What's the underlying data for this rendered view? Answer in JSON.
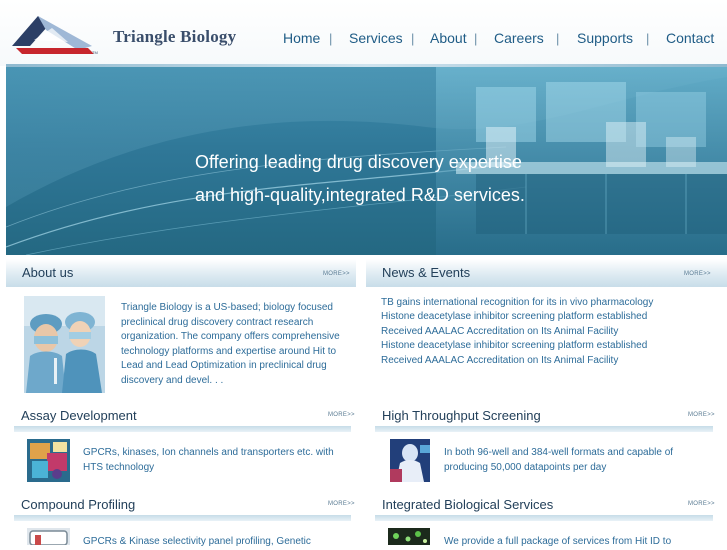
{
  "brand": {
    "name": "Triangle Biology"
  },
  "nav": {
    "items": [
      {
        "label": "Home"
      },
      {
        "label": "Services"
      },
      {
        "label": "About"
      },
      {
        "label": "Careers"
      },
      {
        "label": "Supports"
      },
      {
        "label": "Contact"
      }
    ],
    "separator": "|"
  },
  "hero": {
    "line1": "Offering leading drug discovery expertise",
    "line2": "and high-quality,integrated R&D services."
  },
  "more_label": "MORE>>",
  "about": {
    "title": "About us",
    "text": " Triangle Biology is a US-based; biology focused preclinical drug discovery contract research organization. The company offers comprehensive technology platforms and expertise around Hit to Lead and Lead Optimization in preclinical drug discovery and devel. . ."
  },
  "news": {
    "title": "News & Events",
    "items": [
      "TB gains international recognition for its in vivo pharmacology",
      "Histone deacetylase inhibitor screening platform established",
      "Received AAALAC Accreditation on Its Animal Facility",
      "Histone deacetylase inhibitor screening platform established",
      "Received AAALAC Accreditation on Its Animal Facility"
    ]
  },
  "services": [
    {
      "title": "Assay Development",
      "text": "GPCRs, kinases, Ion channels and transporters etc. with HTS technology"
    },
    {
      "title": "High Throughput Screening",
      "text": "In both 96-well and 384-well formats and capable of producing 50,000 datapoints per day"
    },
    {
      "title": "Compound Profiling",
      "text": "GPCRs & Kinase selectivity panel profiling, Genetic"
    },
    {
      "title": "Integrated Biological Services",
      "text": "We provide a full package of services from Hit ID to"
    }
  ],
  "colors": {
    "link": "#2d6c99",
    "nav": "#1f5c86",
    "heading": "#23405a",
    "hero": "#2f7797"
  }
}
